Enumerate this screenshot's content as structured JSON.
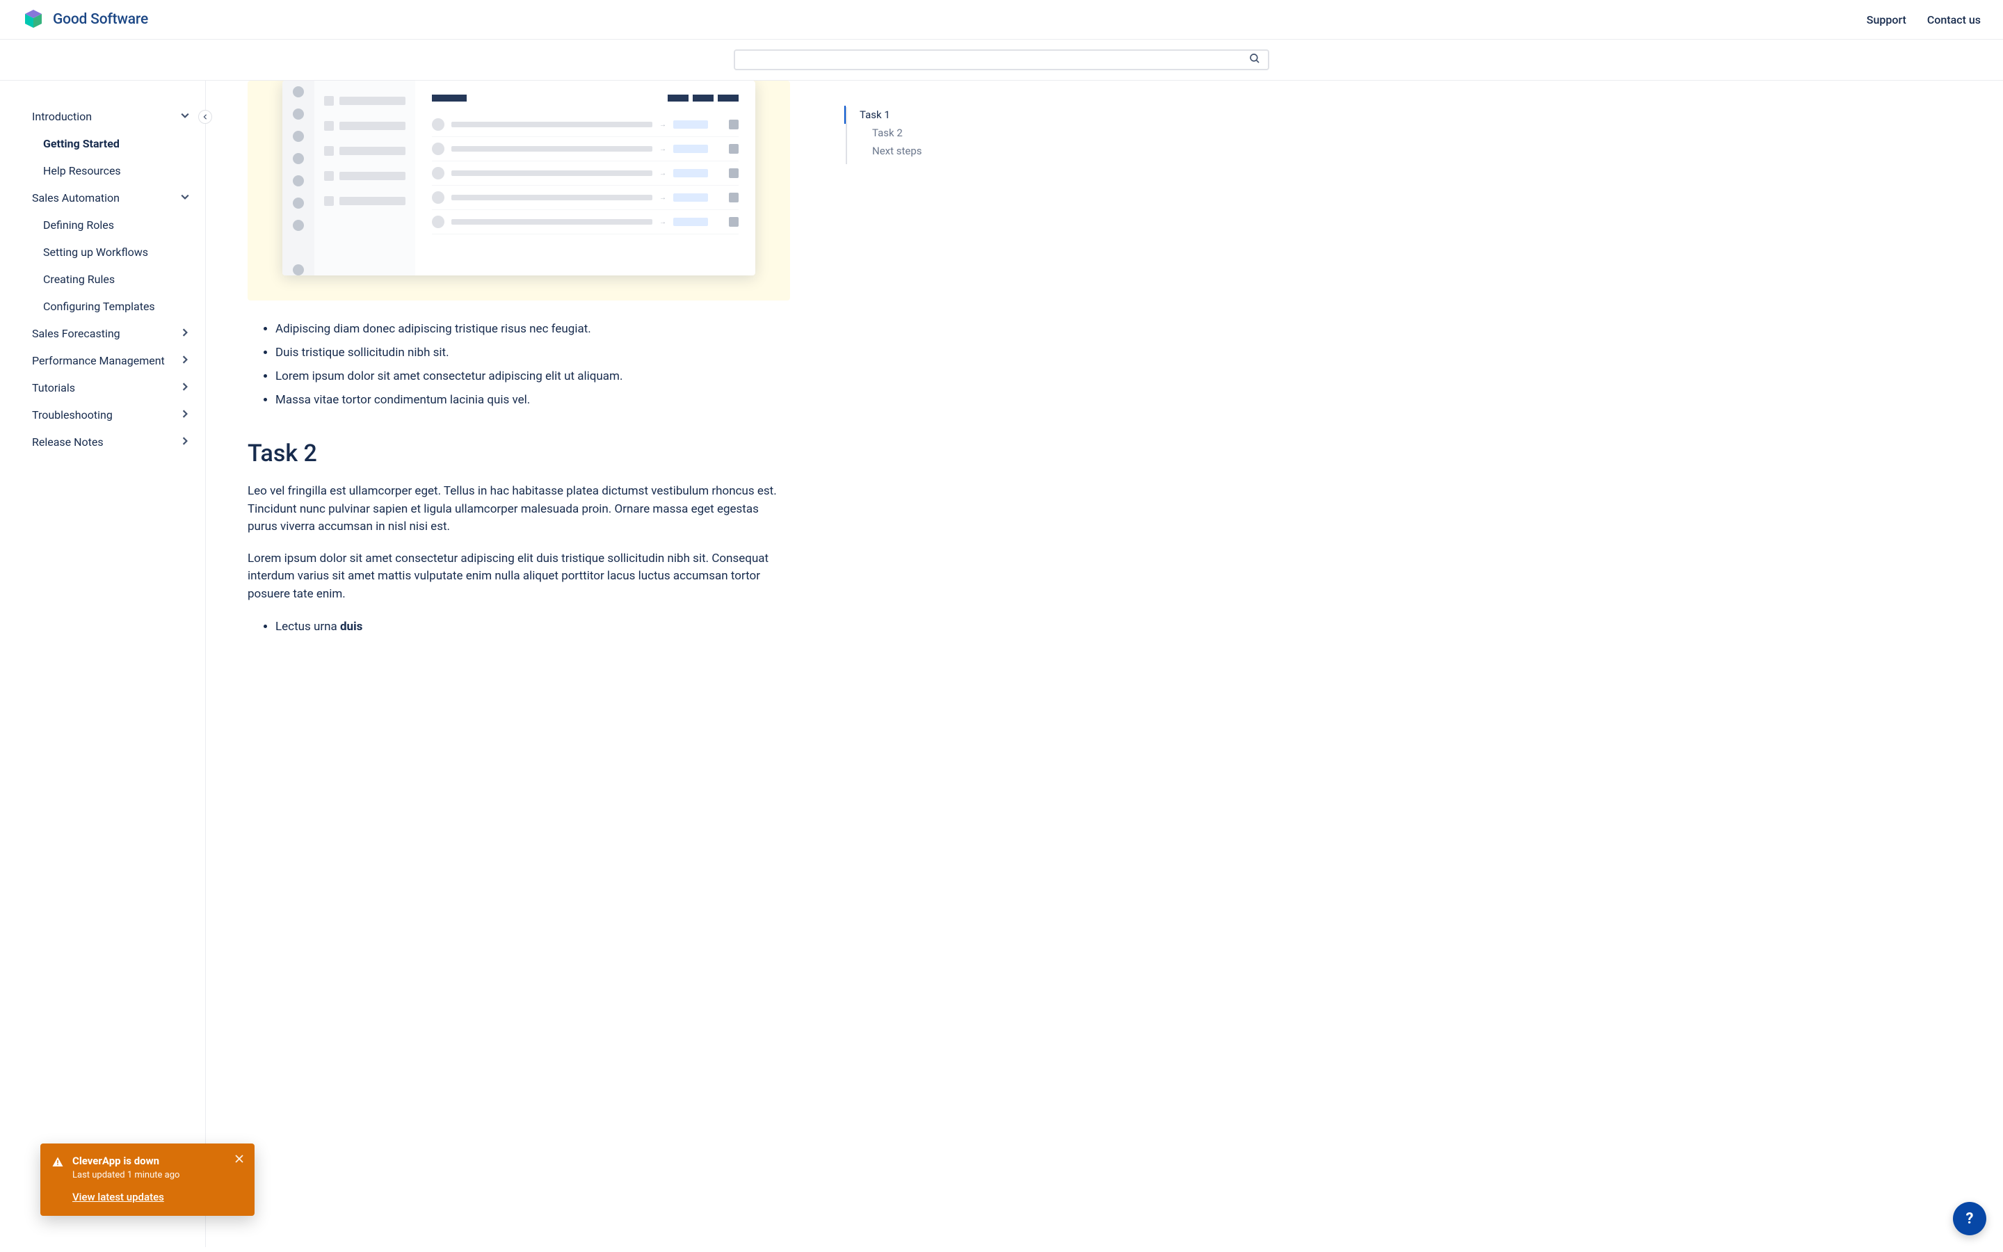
{
  "brand": {
    "name": "Good Software"
  },
  "header": {
    "links": [
      "Support",
      "Contact us"
    ]
  },
  "search": {
    "placeholder": ""
  },
  "sidebar": {
    "sections": [
      {
        "label": "Introduction",
        "expanded": true,
        "children": [
          {
            "label": "Getting Started",
            "active": true
          },
          {
            "label": "Help Resources"
          }
        ]
      },
      {
        "label": "Sales Automation",
        "expanded": true,
        "children": [
          {
            "label": "Defining Roles"
          },
          {
            "label": "Setting up Workflows"
          },
          {
            "label": "Creating Rules"
          },
          {
            "label": "Configuring Templates"
          }
        ]
      },
      {
        "label": "Sales Forecasting",
        "expanded": false
      },
      {
        "label": "Performance Management",
        "expanded": false
      },
      {
        "label": "Tutorials",
        "expanded": false
      },
      {
        "label": "Troubleshooting",
        "expanded": false
      },
      {
        "label": "Release Notes",
        "expanded": false
      }
    ]
  },
  "content": {
    "bullets": [
      "Adipiscing diam donec adipiscing tristique risus nec feugiat.",
      "Duis tristique sollicitudin nibh sit.",
      "Lorem ipsum dolor sit amet consectetur adipiscing elit ut aliquam.",
      "Massa vitae tortor condimentum lacinia quis vel."
    ],
    "task2_heading": "Task 2",
    "task2_p1": "Leo vel fringilla est ullamcorper eget. Tellus in hac habitasse platea dictumst vestibulum rhoncus est. Tincidunt nunc pulvinar sapien et ligula ullamcorper malesuada proin. Ornare massa eget egestas purus viverra accumsan in nisl nisi est.",
    "task2_p2": "Lorem ipsum dolor sit amet consectetur adipiscing elit duis tristique sollicitudin nibh sit. Consequat interdum varius sit amet mattis vulputate enim nulla aliquet porttitor lacus luctus accumsan tortor posuere tate enim.",
    "task2_sub1_prefix": "Lectus urna ",
    "task2_sub1_bold": "duis"
  },
  "toc": {
    "items": [
      {
        "label": "Task 1",
        "active": true
      },
      {
        "label": "Task 2",
        "active": false
      },
      {
        "label": "Next steps",
        "active": false
      }
    ]
  },
  "toast": {
    "title": "CleverApp is down",
    "subtitle": "Last updated 1 minute ago",
    "link": "View latest updates"
  },
  "help_fab": "?"
}
